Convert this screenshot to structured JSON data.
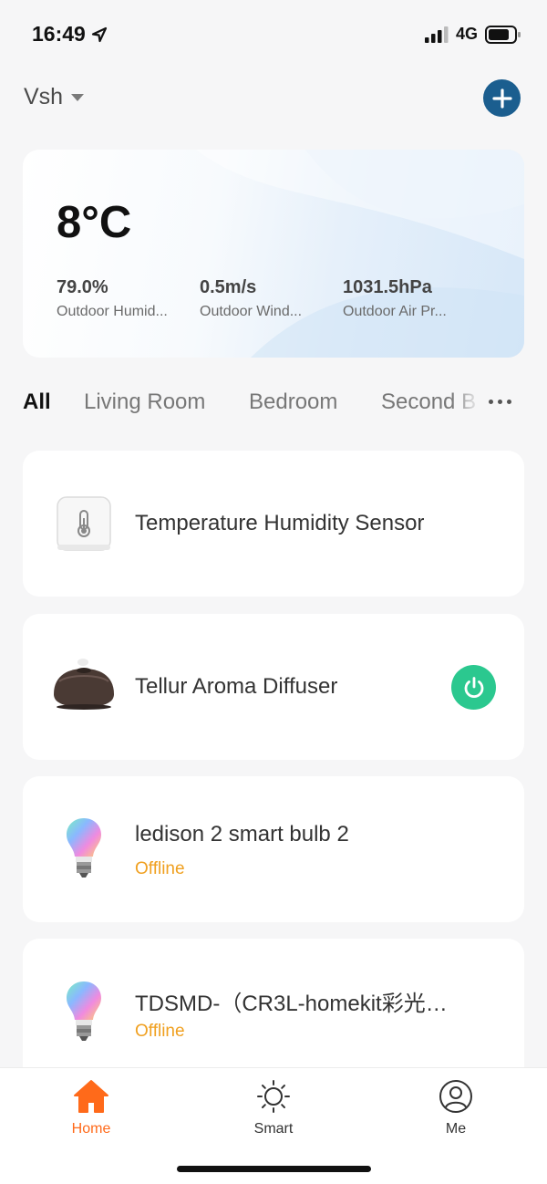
{
  "status_bar": {
    "time": "16:49",
    "network": "4G"
  },
  "header": {
    "home_name": "Vsh",
    "icons": [
      "chevron-down-icon",
      "plus-icon"
    ]
  },
  "weather": {
    "temperature": "8°C",
    "stats": [
      {
        "value": "79.0%",
        "label": "Outdoor Humid..."
      },
      {
        "value": "0.5m/s",
        "label": "Outdoor Wind..."
      },
      {
        "value": "1031.5hPa",
        "label": "Outdoor Air Pr..."
      }
    ]
  },
  "rooms": {
    "tabs": [
      "All",
      "Living Room",
      "Bedroom",
      "Second B"
    ],
    "active": "All"
  },
  "devices": [
    {
      "name": "Temperature Humidity Sensor",
      "status": "",
      "icon": "thermometer-sensor-icon"
    },
    {
      "name": "Tellur Aroma Diffuser",
      "status": "",
      "icon": "aroma-diffuser-icon",
      "power_on": true
    },
    {
      "name": "ledison 2 smart   bulb 2",
      "status": "Offline",
      "icon": "rgb-bulb-icon"
    },
    {
      "name": "TDSMD-（CR3L-homekit彩光…",
      "status": "Offline",
      "icon": "rgb-bulb-icon"
    }
  ],
  "bottom_nav": {
    "items": [
      {
        "label": "Home",
        "icon": "home-icon",
        "active": true
      },
      {
        "label": "Smart",
        "icon": "sun-icon",
        "active": false
      },
      {
        "label": "Me",
        "icon": "user-icon",
        "active": false
      }
    ]
  },
  "colors": {
    "accent_blue": "#1b5e8f",
    "power_green": "#2bc88f",
    "offline_orange": "#f0a020",
    "nav_active": "#ff6a1a"
  }
}
